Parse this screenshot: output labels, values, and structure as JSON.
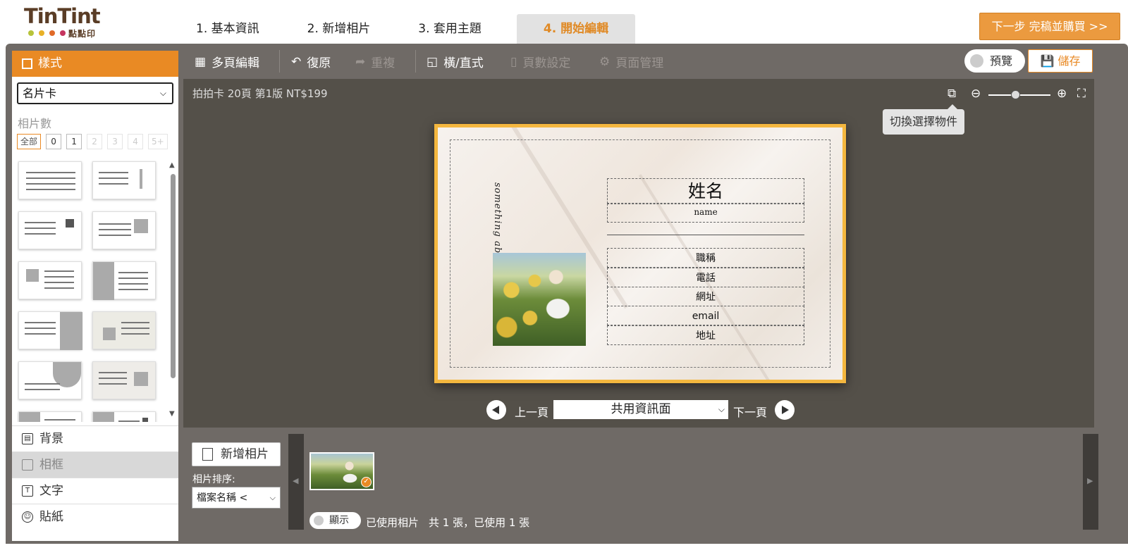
{
  "logo": {
    "text": "TinTint",
    "sub": "點點印",
    "dot_colors": [
      "#b7c33a",
      "#e8b127",
      "#e06a28",
      "#c6365f"
    ]
  },
  "steps": [
    {
      "label": "1. 基本資訊"
    },
    {
      "label": "2. 新增相片"
    },
    {
      "label": "3. 套用主題"
    },
    {
      "label": "4. 開始編輯",
      "active": true
    }
  ],
  "next_button": "下一步 完稿並購買 >>",
  "left_panel": {
    "header": "樣式",
    "style_select": "名片卡",
    "photo_count_label": "相片數",
    "counts": [
      "全部",
      "0",
      "1",
      "2",
      "3",
      "4",
      "5+"
    ],
    "tabs": [
      {
        "label": "背景",
        "icon": "background-icon"
      },
      {
        "label": "相框",
        "icon": "frame-icon",
        "disabled": true
      },
      {
        "label": "文字",
        "icon": "text-icon"
      },
      {
        "label": "貼紙",
        "icon": "sticker-icon"
      }
    ]
  },
  "toolbar": {
    "multi_edit": "多頁編輯",
    "undo": "復原",
    "redo": "重複",
    "orientation": "橫/直式",
    "page_count": "頁數設定",
    "page_manage": "頁面管理",
    "preview": "預覽",
    "save": "儲存"
  },
  "canvas": {
    "product_info": "拍拍卡 20頁 第1版 NT$199",
    "tooltip": "切換選擇物件",
    "card": {
      "vertical_text": "something about me",
      "name": "姓名",
      "name_en": "name",
      "fields": [
        "職稱",
        "電話",
        "網址",
        "email",
        "地址"
      ]
    },
    "pager": {
      "prev": "上一頁",
      "next": "下一頁",
      "page": "共用資訊面"
    }
  },
  "tray": {
    "add_photo": "新增相片",
    "sort_label": "相片排序:",
    "sort_value": "檔案名稱 <",
    "show_toggle": "顯示",
    "used_label": "已使用相片",
    "used_count": "共 1 張，已使用 1 張"
  },
  "colors": {
    "accent": "#e98a24",
    "frame": "#6f6a66",
    "canvas": "#545049",
    "card_border": "#f4b73f"
  }
}
